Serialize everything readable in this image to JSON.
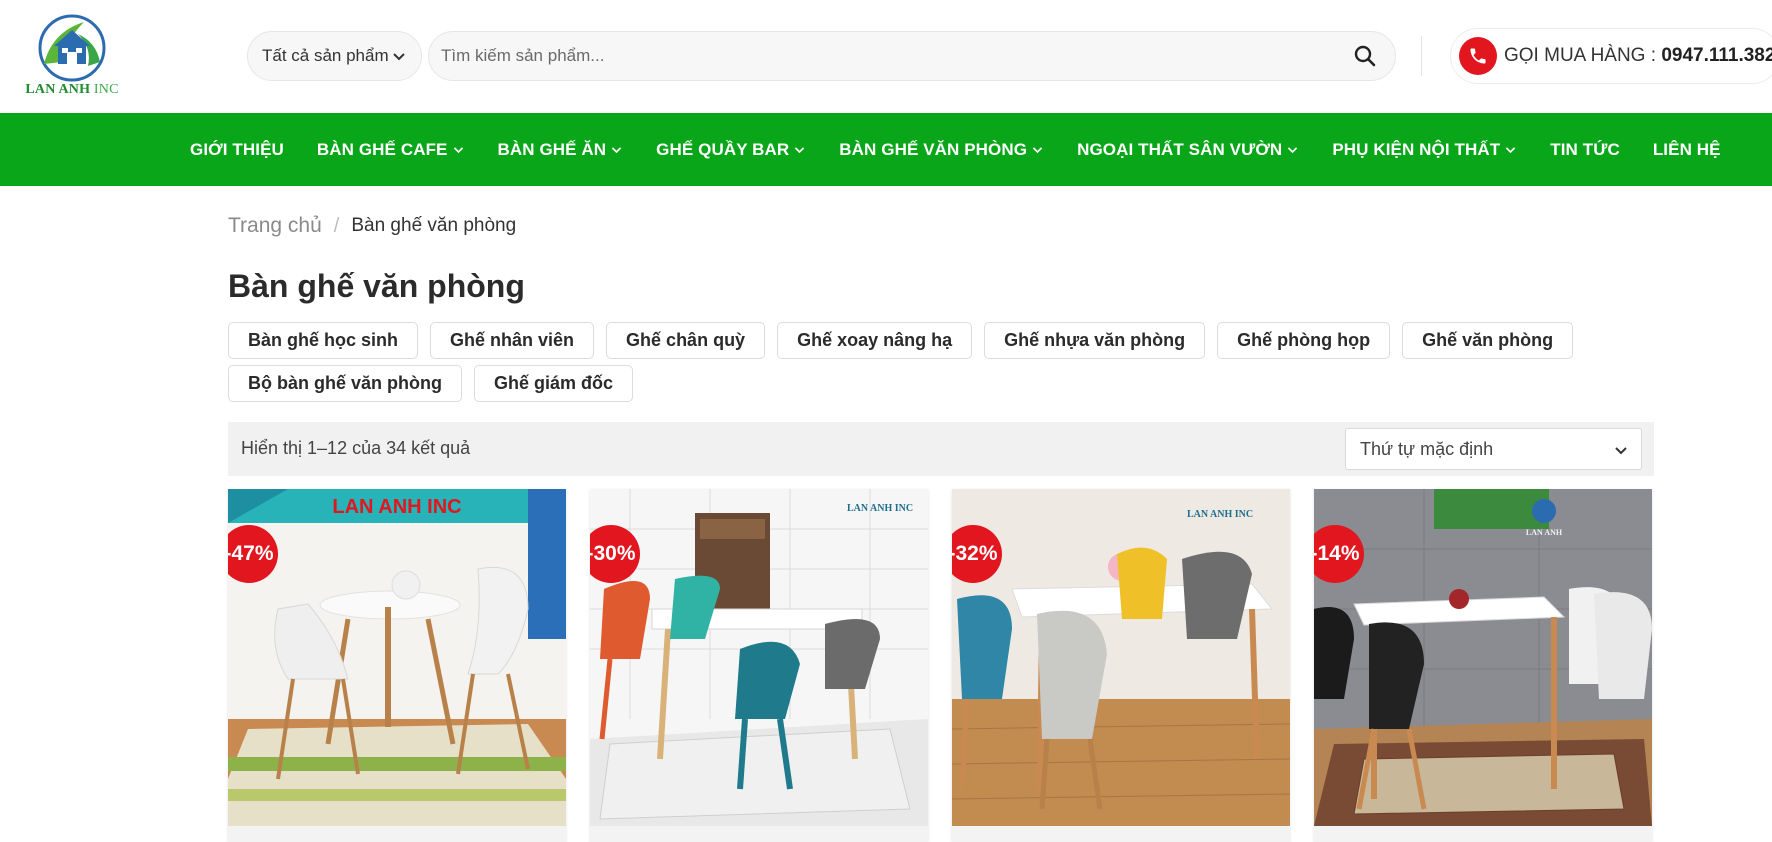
{
  "header": {
    "logo_text_main": "LAN ANH",
    "logo_text_inc": "INC",
    "category_select": "Tất cả sản phẩm",
    "search_placeholder": "Tìm kiếm sản phẩm...",
    "hotline_label": "GỌI MUA HÀNG : ",
    "hotline_number": "0947.111.382"
  },
  "nav": {
    "items": [
      {
        "label": "GIỚI THIỆU",
        "dropdown": false
      },
      {
        "label": "BÀN GHẾ CAFE",
        "dropdown": true
      },
      {
        "label": "BÀN GHẾ ĂN",
        "dropdown": true
      },
      {
        "label": "GHẾ QUẦY BAR",
        "dropdown": true
      },
      {
        "label": "BÀN GHẾ VĂN PHÒNG",
        "dropdown": true
      },
      {
        "label": "NGOẠI THẤT SÂN VƯỜN",
        "dropdown": true
      },
      {
        "label": "PHỤ KIỆN NỘI THẤT",
        "dropdown": true
      },
      {
        "label": "TIN TỨC",
        "dropdown": false
      },
      {
        "label": "LIÊN HỆ",
        "dropdown": false
      }
    ]
  },
  "breadcrumb": {
    "home": "Trang chủ",
    "separator": "/",
    "current": "Bàn ghế văn phòng"
  },
  "page_title": "Bàn ghế văn phòng",
  "subcategories": [
    "Bàn ghế học sinh",
    "Ghế nhân viên",
    "Ghế chân quỳ",
    "Ghế xoay nâng hạ",
    "Ghế nhựa văn phòng",
    "Ghế phòng họp",
    "Ghế văn phòng",
    "Bộ bàn ghế văn phòng",
    "Ghế giám đốc"
  ],
  "results": {
    "count_text": "Hiển thị 1–12 của 34 kết quả",
    "sort_selected": "Thứ tự mặc định"
  },
  "products": [
    {
      "discount": "-47%",
      "banner_text": "LAN ANH INC"
    },
    {
      "discount": "-30%",
      "brand_mark": "LAN ANH INC"
    },
    {
      "discount": "-32%",
      "brand_mark": "LAN ANH INC"
    },
    {
      "discount": "-14%",
      "brand_mark": "LAN ANH"
    }
  ],
  "colors": {
    "nav_bg": "#0aa61a",
    "badge_red": "#e2161e",
    "phone_red": "#e2161e"
  }
}
